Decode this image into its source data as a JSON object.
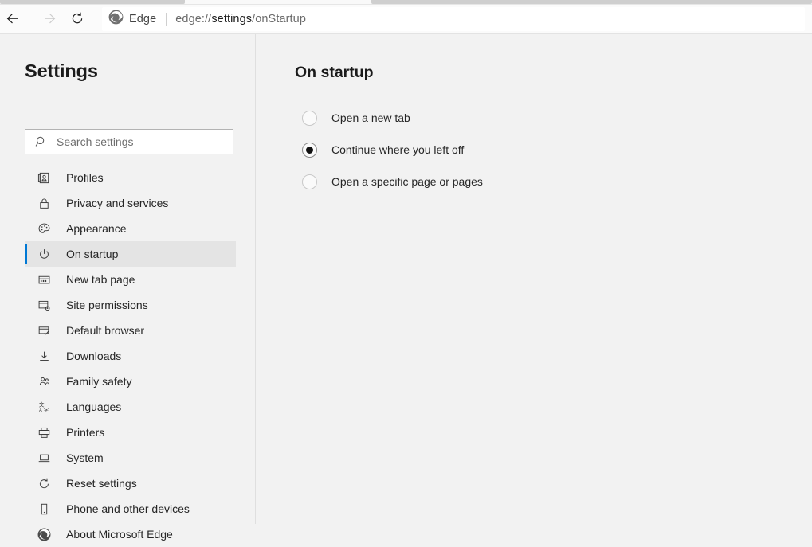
{
  "browser": {
    "nav": {
      "back_icon": "arrow-left-icon",
      "forward_icon": "arrow-right-icon",
      "reload_icon": "reload-icon"
    },
    "address_bar": {
      "brand_icon": "edge-logo-icon",
      "brand_label": "Edge",
      "url_prefix": "edge://",
      "url_strong": "settings",
      "url_suffix": "/onStartup",
      "full_url": "edge://settings/onStartup"
    }
  },
  "sidebar": {
    "title": "Settings",
    "search": {
      "placeholder": "Search settings",
      "value": "",
      "icon": "search-icon"
    },
    "items": [
      {
        "label": "Profiles",
        "icon": "profile-card-icon",
        "selected": false
      },
      {
        "label": "Privacy and services",
        "icon": "lock-icon",
        "selected": false
      },
      {
        "label": "Appearance",
        "icon": "palette-icon",
        "selected": false
      },
      {
        "label": "On startup",
        "icon": "power-icon",
        "selected": true
      },
      {
        "label": "New tab page",
        "icon": "new-tab-page-icon",
        "selected": false
      },
      {
        "label": "Site permissions",
        "icon": "site-permissions-icon",
        "selected": false
      },
      {
        "label": "Default browser",
        "icon": "default-browser-icon",
        "selected": false
      },
      {
        "label": "Downloads",
        "icon": "download-icon",
        "selected": false
      },
      {
        "label": "Family safety",
        "icon": "family-icon",
        "selected": false
      },
      {
        "label": "Languages",
        "icon": "languages-icon",
        "selected": false
      },
      {
        "label": "Printers",
        "icon": "printer-icon",
        "selected": false
      },
      {
        "label": "System",
        "icon": "laptop-icon",
        "selected": false
      },
      {
        "label": "Reset settings",
        "icon": "reset-icon",
        "selected": false
      },
      {
        "label": "Phone and other devices",
        "icon": "phone-icon",
        "selected": false
      },
      {
        "label": "About Microsoft Edge",
        "icon": "edge-logo-icon",
        "selected": false
      }
    ]
  },
  "main": {
    "heading": "On startup",
    "options": [
      {
        "label": "Open a new tab",
        "checked": false
      },
      {
        "label": "Continue where you left off",
        "checked": true
      },
      {
        "label": "Open a specific page or pages",
        "checked": false
      }
    ]
  },
  "colors": {
    "accent": "#0078d4",
    "page_bg": "#f2f2f2",
    "selected_row_bg": "#e4e4e4",
    "text": "#262626",
    "muted_text": "#6e6e6e"
  }
}
